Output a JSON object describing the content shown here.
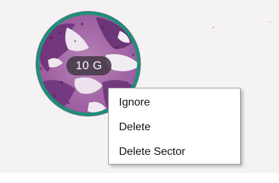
{
  "slide": {
    "core_label": "10 G",
    "ring_color": "#1e9077"
  },
  "context_menu": {
    "items": [
      {
        "label": "Ignore"
      },
      {
        "label": "Delete"
      },
      {
        "label": "Delete Sector"
      }
    ]
  }
}
